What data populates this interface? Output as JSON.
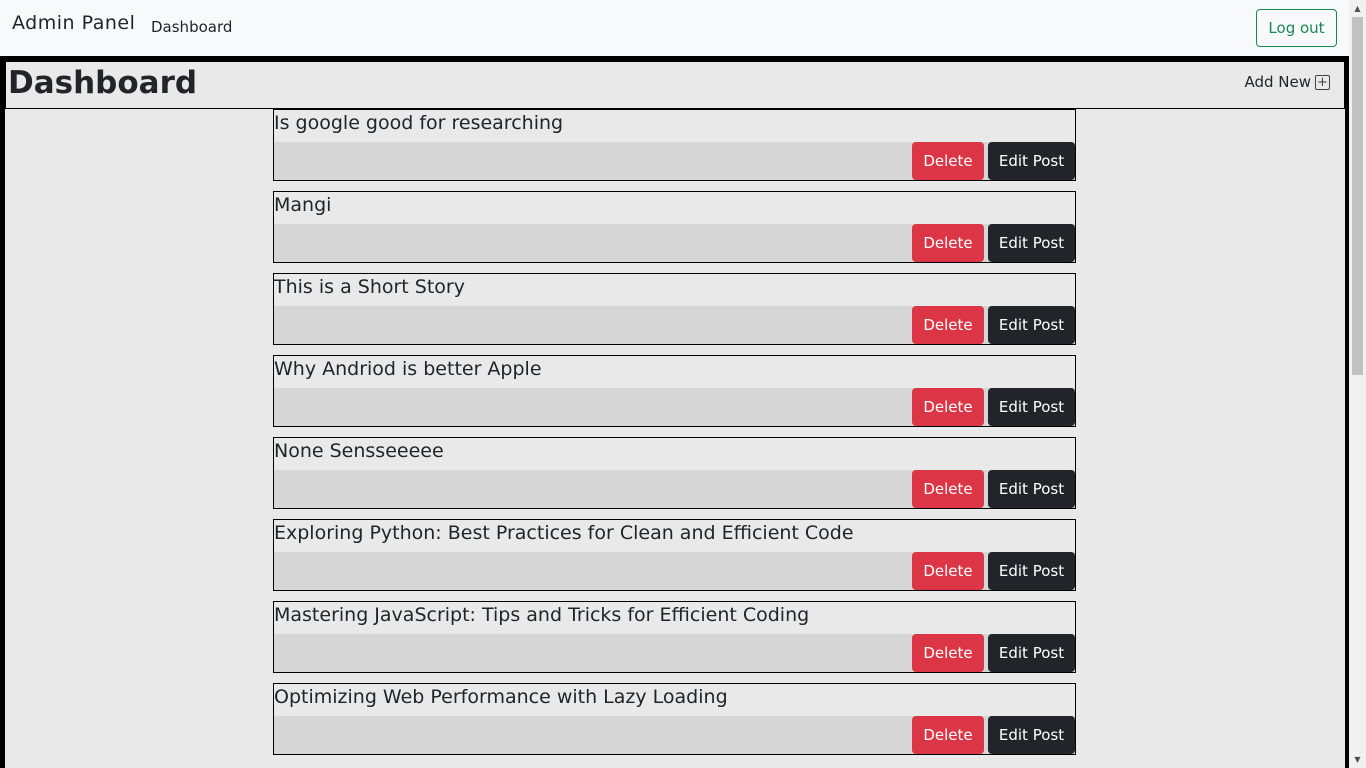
{
  "navbar": {
    "brand": "Admin Panel",
    "nav_link": "Dashboard",
    "logout_label": "Log out"
  },
  "header": {
    "title": "Dashboard",
    "add_new_label": "Add New",
    "add_icon": "plus-square-icon"
  },
  "post_actions": {
    "delete_label": "Delete",
    "edit_label": "Edit Post"
  },
  "posts": [
    {
      "title": "Is google good for researching"
    },
    {
      "title": "Mangi"
    },
    {
      "title": "This is a Short Story"
    },
    {
      "title": "Why Andriod is better Apple"
    },
    {
      "title": "None Sensseeeee"
    },
    {
      "title": "Exploring Python: Best Practices for Clean and Efficient Code"
    },
    {
      "title": "Mastering JavaScript: Tips and Tricks for Efficient Coding"
    },
    {
      "title": "Optimizing Web Performance with Lazy Loading"
    }
  ],
  "colors": {
    "delete": "#dc3545",
    "edit": "#212529",
    "logout": "#198754"
  }
}
